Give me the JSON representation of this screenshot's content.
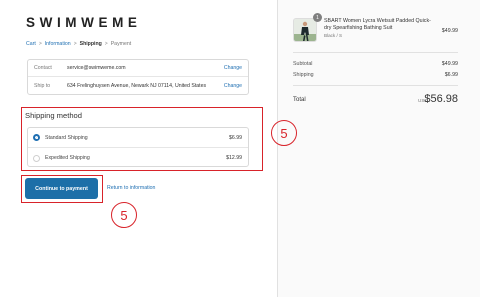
{
  "store": {
    "logo": "SWIMWEME"
  },
  "breadcrumb": {
    "items": [
      "Cart",
      "Information",
      "Shipping",
      "Payment"
    ],
    "separator": ">"
  },
  "review": {
    "contact": {
      "label": "Contact",
      "value": "service@swimweme.com",
      "action": "Change"
    },
    "ship_to": {
      "label": "Ship to",
      "value": "634 Frelinghuysen Avenue, Newark NJ 07114, United States",
      "action": "Change"
    }
  },
  "shipping": {
    "heading": "Shipping method",
    "options": [
      {
        "name": "Standard Shipping",
        "price": "$6.99",
        "selected": true
      },
      {
        "name": "Expedited Shipping",
        "price": "$12.99",
        "selected": false
      }
    ]
  },
  "actions": {
    "continue_label": "Continue to payment",
    "return_label": "Return to information"
  },
  "annotations": {
    "ship_method": "5",
    "continue": "5"
  },
  "order": {
    "product": {
      "name": "SBART Women Lycra Wetsuit Padded Quick-dry Spearfishing Bathing Suit",
      "variant": "Black / S",
      "price": "$49.99",
      "quantity": "1"
    },
    "subtotal_label": "Subtotal",
    "subtotal": "$49.99",
    "shipping_label": "Shipping",
    "shipping": "$6.99",
    "total_label": "Total",
    "currency": "USD",
    "total": "$56.98"
  },
  "colors": {
    "accent": "#1d6fa8",
    "annotation": "#d8232a"
  }
}
